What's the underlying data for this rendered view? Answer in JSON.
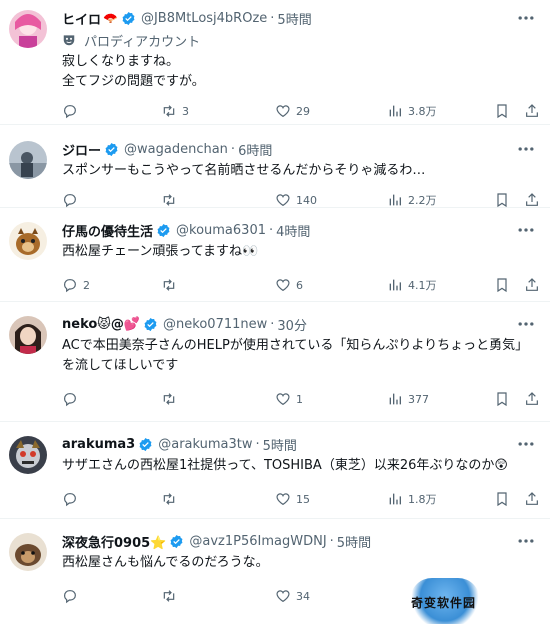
{
  "tweets": [
    {
      "display_name": "ヒイロ",
      "handle": "@JB8MtLosj4bROze",
      "time": "5時間",
      "parody": "パロディアカウント",
      "text": "寂しくなりますね。\n全てフジの問題ですが。",
      "replies": "",
      "retweets": "3",
      "likes": "29",
      "views": "3.8万"
    },
    {
      "display_name": "ジロー",
      "handle": "@wagadenchan",
      "time": "6時間",
      "text": "スポンサーもこうやって名前晒させるんだからそりゃ減るわ…",
      "replies": "",
      "retweets": "",
      "likes": "140",
      "views": "2.2万"
    },
    {
      "display_name": "仔馬の優待生活",
      "handle": "@kouma6301",
      "time": "4時間",
      "text": "西松屋チェーン頑張ってますね👀",
      "replies": "2",
      "retweets": "",
      "likes": "6",
      "views": "4.1万"
    },
    {
      "display_name": "neko😾@💕",
      "handle": "@neko0711new",
      "time": "30分",
      "text": "ACで本田美奈子さんのHELPが使用されている「知らんぷりよりちょっと勇気」を流してほしいです",
      "replies": "",
      "retweets": "",
      "likes": "1",
      "views": "377"
    },
    {
      "display_name": "arakuma3",
      "handle": "@arakuma3tw",
      "time": "5時間",
      "text": "サザエさんの西松屋1社提供って、TOSHIBA（東芝）以来26年ぶりなのか😲",
      "replies": "",
      "retweets": "",
      "likes": "15",
      "views": "1.8万"
    },
    {
      "display_name": "深夜急行0905⭐",
      "handle": "@avz1P56ImagWDNJ",
      "time": "5時間",
      "text": "西松屋さんも悩んでるのだろうな。",
      "replies": "",
      "retweets": "",
      "likes": "34",
      "views": ""
    }
  ],
  "icons": {
    "verified": "verified-badge-icon",
    "reply": "reply-icon",
    "retweet": "retweet-icon",
    "like": "heart-icon",
    "views": "views-chart-icon",
    "bookmark": "bookmark-icon",
    "share": "share-icon",
    "more": "more-dots-icon"
  },
  "colors": {
    "verified": "#1d9bf0",
    "secondary_text": "#536471",
    "primary_text": "#0f1419",
    "divider": "#eff3f4"
  },
  "watermark": "奇变软件园"
}
